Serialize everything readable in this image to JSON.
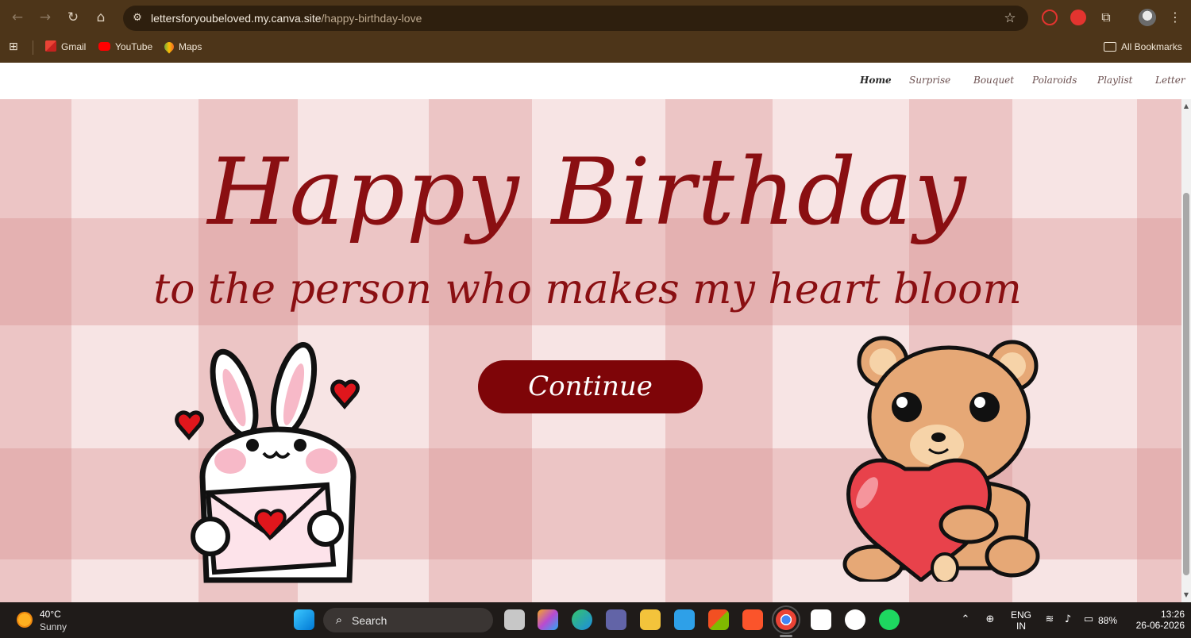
{
  "browser": {
    "url_host": "lettersforyoubeloved.my.canva.site",
    "url_path": "/happy-birthday-love",
    "bookmarks": [
      {
        "label": "Gmail"
      },
      {
        "label": "YouTube"
      },
      {
        "label": "Maps"
      }
    ],
    "all_bookmarks_label": "All Bookmarks",
    "icons": {
      "back": "back-arrow-icon",
      "forward": "forward-arrow-icon",
      "reload": "reload-icon",
      "home": "home-icon",
      "site_info": "tune-icon",
      "bookmark_star": "star-icon",
      "extensions": "puzzle-icon",
      "menu": "kebab-menu-icon"
    }
  },
  "site": {
    "nav": [
      {
        "label": "Home",
        "active": true
      },
      {
        "label": "Surprise",
        "active": false
      },
      {
        "label": "Bouquet",
        "active": false
      },
      {
        "label": "Polaroids",
        "active": false
      },
      {
        "label": "Playlist",
        "active": false
      },
      {
        "label": "Letter",
        "active": false
      }
    ],
    "title": "Happy Birthday",
    "subtitle": "to the person who makes my heart bloom",
    "cta_label": "Continue",
    "colors": {
      "accent": "#8a0f12",
      "button": "#7e0508",
      "background": "#f6dada",
      "gingham": "#e3a6a6"
    }
  },
  "taskbar": {
    "weather": {
      "temp": "40°C",
      "condition": "Sunny"
    },
    "search_label": "Search",
    "language": {
      "line1": "ENG",
      "line2": "IN"
    },
    "battery": "88%",
    "time": "13:26",
    "date": "26-06-2026"
  }
}
